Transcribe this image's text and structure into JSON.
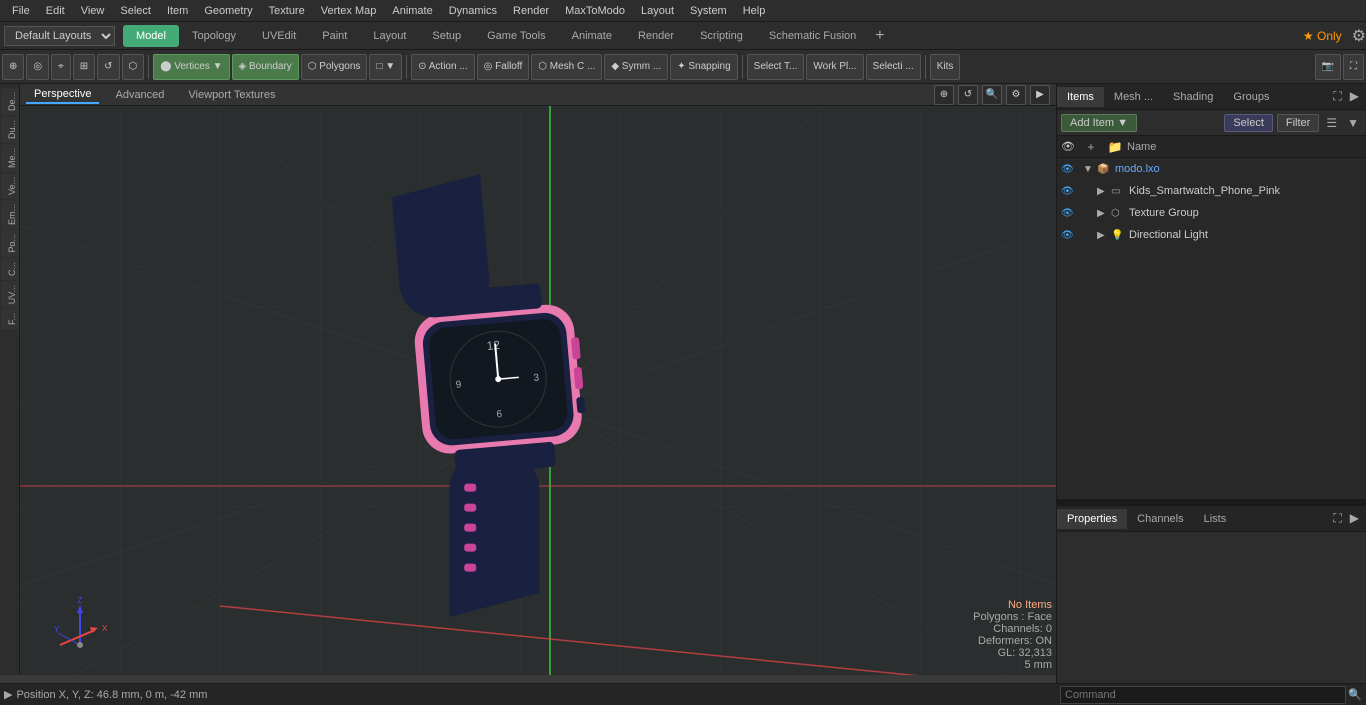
{
  "menubar": {
    "items": [
      "File",
      "Edit",
      "View",
      "Select",
      "Item",
      "Geometry",
      "Texture",
      "Vertex Map",
      "Animate",
      "Dynamics",
      "Render",
      "MaxToModo",
      "Layout",
      "System",
      "Help"
    ]
  },
  "modebar": {
    "layout_label": "Default Layouts",
    "tabs": [
      "Model",
      "Topology",
      "UVEdit",
      "Paint",
      "Layout",
      "Setup",
      "Game Tools",
      "Animate",
      "Render",
      "Scripting",
      "Schematic Fusion"
    ],
    "active_tab": "Model",
    "only_label": "★ Only"
  },
  "toolbar": {
    "buttons": [
      "⊕",
      "◎",
      "⌖",
      "⊞",
      "↺",
      "⬡",
      "Vertices ▼",
      "Boundary",
      "Polygons",
      "□ ▼",
      "⊙ Action ...",
      "◎ Falloff",
      "⬡ Mesh C ...",
      "◆ Symm ...",
      "✦ Snapping",
      "Select T...",
      "Work Pl...",
      "Selecti ...",
      "Kits"
    ],
    "active": "Boundary"
  },
  "viewport": {
    "tabs": [
      "Perspective",
      "Advanced",
      "Viewport Textures"
    ],
    "active_tab": "Perspective",
    "status": {
      "no_items": "No Items",
      "polygons": "Polygons : Face",
      "channels": "Channels: 0",
      "deformers": "Deformers: ON",
      "gl": "GL: 32,313",
      "size": "5 mm"
    }
  },
  "status_bar": {
    "position": "Position X, Y, Z:   46.8 mm, 0 m, -42 mm"
  },
  "command_bar": {
    "placeholder": "Command",
    "prompt": "▶"
  },
  "sidebar_labels": [
    "De...",
    "Du...",
    "Me...",
    "Ve...",
    "Em...",
    "Po...",
    "C...",
    "UV...",
    "F..."
  ],
  "right_panel": {
    "tabs": [
      "Items",
      "Mesh ...",
      "Shading",
      "Groups"
    ],
    "active_tab": "Items",
    "toolbar": {
      "add_item": "Add Item",
      "select": "Select",
      "filter": "Filter"
    },
    "header": {
      "name_col": "Name"
    },
    "scene_tree": [
      {
        "id": "modo_lxo",
        "label": "modo.lxo",
        "indent": 0,
        "type": "file",
        "icon": "📦",
        "expanded": true,
        "eye": true
      },
      {
        "id": "kids_smartwatch",
        "label": "Kids_Smartwatch_Phone_Pink",
        "indent": 1,
        "type": "mesh",
        "icon": "▭",
        "expanded": false,
        "eye": true
      },
      {
        "id": "texture_group",
        "label": "Texture Group",
        "indent": 1,
        "type": "group",
        "icon": "⬡",
        "expanded": false,
        "eye": true
      },
      {
        "id": "directional_light",
        "label": "Directional Light",
        "indent": 1,
        "type": "light",
        "icon": "💡",
        "expanded": false,
        "eye": true
      }
    ],
    "properties": {
      "tabs": [
        "Properties",
        "Channels",
        "Lists"
      ],
      "active_tab": "Properties"
    }
  },
  "colors": {
    "accent_blue": "#4af",
    "accent_green": "#4a7",
    "grid_line": "#333",
    "bg_dark": "#2a2a2a",
    "bg_medium": "#2d2d2d",
    "axis_x": "#e44",
    "axis_y": "#4e4",
    "axis_z": "#44e"
  }
}
